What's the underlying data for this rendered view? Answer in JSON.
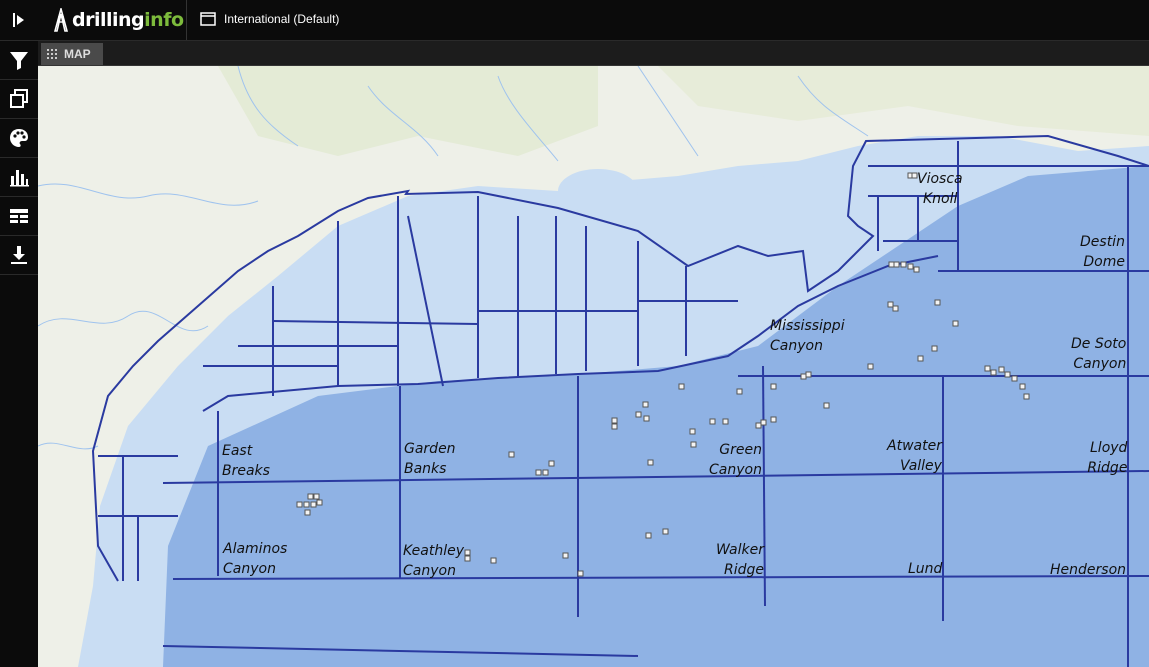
{
  "header": {
    "logo_text_main": "drilling",
    "logo_text_accent": "info",
    "workspace_label": "International (Default)"
  },
  "sidebar": {
    "items": [
      {
        "icon": "filter-icon"
      },
      {
        "icon": "layers-icon"
      },
      {
        "icon": "palette-icon"
      },
      {
        "icon": "chart-icon"
      },
      {
        "icon": "table-icon"
      },
      {
        "icon": "download-icon"
      }
    ]
  },
  "tabs": {
    "map_label": "MAP"
  },
  "map": {
    "areas": {
      "viosca_l1": "Viosca",
      "viosca_l2": "Knoll",
      "destin_l1": "Destin",
      "destin_l2": "Dome",
      "mississippi_l1": "Mississippi",
      "mississippi_l2": "Canyon",
      "desoto_l1": "De Soto",
      "desoto_l2": "Canyon",
      "eastbreaks_l1": "East",
      "eastbreaks_l2": "Breaks",
      "gardenbanks_l1": "Garden",
      "gardenbanks_l2": "Banks",
      "green_l1": "Green",
      "green_l2": "Canyon",
      "atwater_l1": "Atwater",
      "atwater_l2": "Valley",
      "lloyd_l1": "Lloyd",
      "lloyd_l2": "Ridge",
      "alaminos_l1": "Alaminos",
      "alaminos_l2": "Canyon",
      "keathley_l1": "Keathley",
      "keathley_l2": "Canyon",
      "walker_l1": "Walker",
      "walker_l2": "Ridge",
      "lund": "Lund",
      "henderson": "Henderson"
    },
    "colors": {
      "land": "#eef0e8",
      "shelf": "#c9ddf3",
      "deep": "#8fb2e4",
      "boundary": "#2a3aa0",
      "brand_green": "#7dbb3c"
    }
  }
}
